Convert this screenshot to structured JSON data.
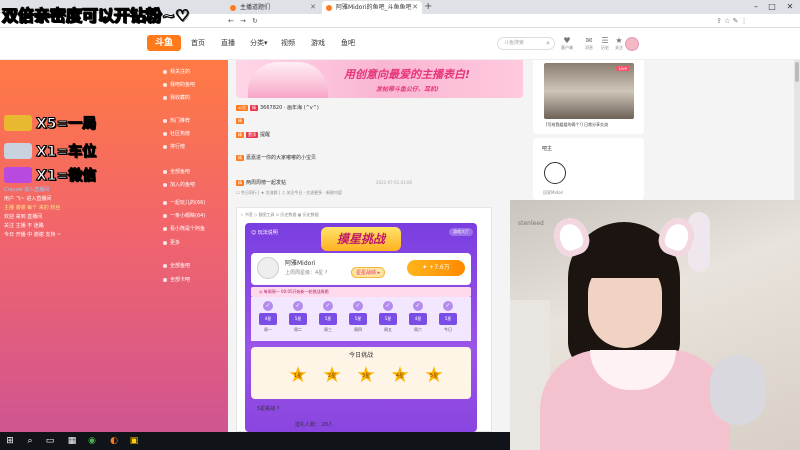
{
  "overlay": {
    "title": "双倍亲密度可以开钻粉~♡",
    "gifts": [
      {
        "text": "X5=一局",
        "color": "#e8b830"
      },
      {
        "text": "X1=车位",
        "color": "#c9d3e0"
      },
      {
        "text": "X1=微信",
        "color": "#b84ae0"
      }
    ],
    "chat": [
      {
        "text": "Crayzel 进入直播间",
        "color": "#8ecbff"
      },
      {
        "text": "用户 飞~ 进入直播间",
        "color": "#ffffff"
      },
      {
        "text": "主播 谢谢 每个 来的 粉丝",
        "color": "#ffe28a"
      },
      {
        "text": "欢迎 来到 直播间",
        "color": "#ffffff"
      },
      {
        "text": "关注 主播 不 迷路",
        "color": "#ffffff"
      },
      {
        "text": "今日 开播 中 谢谢 支持 ~",
        "color": "#ffffff"
      }
    ]
  },
  "browser": {
    "tabs": [
      {
        "label": "主播道题们",
        "active": false
      },
      {
        "label": "阿雅Midori的鱼吧_斗鱼鱼吧",
        "active": true
      }
    ],
    "new_tab": "+",
    "controls": {
      "min": "–",
      "max": "□",
      "close": "✕"
    },
    "nav": {
      "back": "←",
      "forward": "→",
      "reload": "↻"
    },
    "addr_icons": "⇪  ☆  ✎  ⋮"
  },
  "site": {
    "logo": "斗鱼",
    "nav": [
      "首页",
      "直播",
      "分类▾",
      "视频",
      "游戏",
      "鱼吧"
    ],
    "search_placeholder": "斗鱼搜索",
    "search_icon": "⌕",
    "header_icons": [
      {
        "icon": "♥",
        "label": "客户端"
      },
      {
        "icon": "✉",
        "label": "消息"
      },
      {
        "icon": "☰",
        "label": "历史"
      },
      {
        "icon": "★",
        "label": "关注"
      }
    ]
  },
  "sidebar": {
    "items": [
      {
        "label": "我关注的",
        "count": ""
      },
      {
        "label": "我吧的鱼吧",
        "count": ""
      },
      {
        "label": "我收藏的",
        "count": ""
      },
      {
        "label": "热门推荐",
        "count": ""
      },
      {
        "label": "社区热榜",
        "count": ""
      },
      {
        "label": "排行榜",
        "count": ""
      },
      {
        "label": "全部鱼吧",
        "count": ""
      },
      {
        "label": "加入的鱼吧",
        "count": ""
      },
      {
        "label": "一起玩儿的(66)",
        "count": ""
      },
      {
        "label": "一条小眼睛(64)",
        "count": ""
      },
      {
        "label": "看小熊是个阿鱼",
        "count": ""
      },
      {
        "label": "更多",
        "count": ""
      },
      {
        "label": "全部鱼吧",
        "count": ""
      },
      {
        "label": "全部卡吧",
        "count": ""
      }
    ]
  },
  "banner": {
    "headline": "用创意向最爱的主播表白!",
    "sub": "发帖带斗鱼公仔、耳机!"
  },
  "posts": [
    {
      "tags": [
        "公告",
        "精"
      ],
      "text": "3667820  ·  画年海 (^v^)"
    },
    {
      "tags": [
        "精"
      ],
      "text": ""
    },
    {
      "tags": [
        "精",
        "置顶"
      ],
      "text": "提醒"
    },
    {
      "tags": [
        "精"
      ],
      "text": "嘉嘉进一你的大家嘟嘟的小宝贝"
    },
    {
      "tags": [
        "精"
      ],
      "text": "两周周榜一起发帖",
      "meta": "2022-07-01 01:00"
    }
  ],
  "post_sub": "☐ 冬日同行  |  ★ 交流群  |  ♫ 关注今日  ·  交流更多  ·  新鲜内容",
  "app": {
    "toolbar": "☆ 书签   ◇ 截图工具   ⊙ 历史数据   ▦ 历史数据",
    "logo": "摸星挑战",
    "left_label": "☺ 玩法说明",
    "right_btn": "游戏大厅",
    "user": {
      "name": "阿雅Midori",
      "level": "上周周星级：4星 ?",
      "btn": "星星战绩 ▸",
      "coins": "✦ +7.6万"
    },
    "strip": "◎ 每周周一 00:05开始新一轮挑战周期",
    "days": [
      {
        "star": "4星",
        "name": "周一"
      },
      {
        "star": "5星",
        "name": "周二"
      },
      {
        "star": "5星",
        "name": "周三"
      },
      {
        "star": "5星",
        "name": "周四"
      },
      {
        "star": "5星",
        "name": "周五"
      },
      {
        "star": "4星",
        "name": "周六"
      },
      {
        "star": "5星",
        "name": "今日"
      }
    ],
    "today_title": "今日挑战",
    "today_stars": [
      "1星",
      "2星",
      "3星",
      "4星",
      "5星"
    ],
    "five_star": "5星挑战 ?",
    "five_star_sub": "送礼人数： 20人"
  },
  "right": {
    "thumb_badge": "Live",
    "caption": "[写给我姐姐的两个!] 日常分享交流",
    "card_title": "吧主",
    "handle": "回家Midori"
  },
  "webcam": {
    "logo": "stenleed"
  },
  "taskbar": {
    "start": "⊞",
    "search": "⌕",
    "taskview": "▭",
    "files": "▦",
    "chrome": "◉",
    "app1": "◐",
    "app2": "▣"
  }
}
